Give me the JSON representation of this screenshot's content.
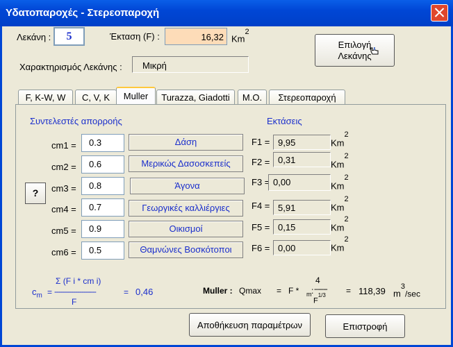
{
  "window": {
    "title": "Υδατοπαροχές - Στερεοπαροχή"
  },
  "basin": {
    "label": "Λεκάνη :",
    "value": "5"
  },
  "area": {
    "label": "Έκταση (F) :",
    "value": "16,32",
    "unit": "Km",
    "unit_exp": "2"
  },
  "select_basin_button": {
    "line1": "Επιλογή",
    "line2": "Λεκάνης"
  },
  "classification": {
    "label": "Χαρακτηρισμός Λεκάνης :",
    "value": "Μικρή"
  },
  "tabs": [
    {
      "label": "F, K-W, W"
    },
    {
      "label": "C, V, K"
    },
    {
      "label": "Muller"
    },
    {
      "label": "Turazza, Giadotti"
    },
    {
      "label": "M.O."
    },
    {
      "label": "Στερεοπαροχή"
    }
  ],
  "coefficients_title": "Συντελεστές απορροής",
  "areas_title": "Εκτάσεις",
  "help_button": "?",
  "rows": [
    {
      "cm_label": "cm1 =",
      "cm_value": "0.3",
      "land": "Δάση",
      "f_label": "F1 =",
      "f_value": "9,95"
    },
    {
      "cm_label": "cm2 =",
      "cm_value": "0.6",
      "land": "Μερικώς Δασοσκεπείς",
      "f_label": "F2 =",
      "f_value": "0,31"
    },
    {
      "cm_label": "cm3 =",
      "cm_value": "0.8",
      "land": "Άγονα",
      "f_label": "F3 =",
      "f_value": "0,00"
    },
    {
      "cm_label": "cm4 =",
      "cm_value": "0.7",
      "land": "Γεωργικές καλλιέργιες",
      "f_label": "F4 =",
      "f_value": "5,91"
    },
    {
      "cm_label": "cm5 =",
      "cm_value": "0.9",
      "land": "Οικισμοί",
      "f_label": "F5 =",
      "f_value": "0,15"
    },
    {
      "cm_label": "cm6 =",
      "cm_value": "0.5",
      "land": "Θαμνώνες Βοσκότοποι",
      "f_label": "F6 =",
      "f_value": "0,00"
    }
  ],
  "km_unit": "Km",
  "km_exp": "2",
  "cm_formula": {
    "numerator": "Σ (F i  * cm i)",
    "divider": "--------------------",
    "denominator": "F",
    "lhs": "c",
    "lhs_sub": "m",
    "eq": "=",
    "result": "0,46"
  },
  "muller_formula": {
    "label": "Muller :",
    "qmax": "Qmax",
    "eq1": "=   F *",
    "sub_m": "m",
    "colon": ":",
    "num": "4",
    "frac": "-------",
    "den": "F",
    "den_exp": "1/3",
    "eq2": "=",
    "result": "118,39",
    "unit": "m",
    "unit_exp": "3",
    "unit_tail": "/sec"
  },
  "save_button": "Αποθήκευση παραμέτρων",
  "back_button": "Επιστροφή"
}
